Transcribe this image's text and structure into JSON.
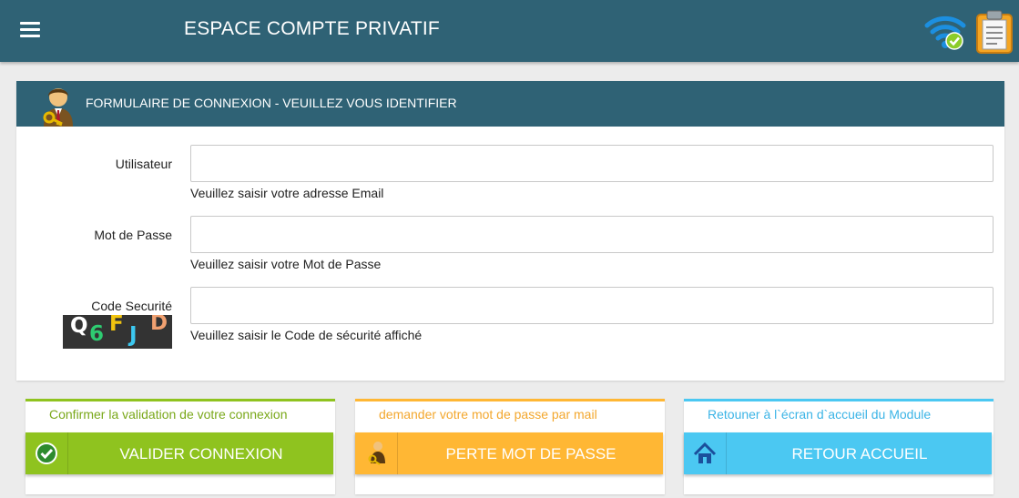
{
  "app": {
    "title": "ESPACE COMPTE PRIVATIF",
    "menu_icon": "hamburger-menu-icon",
    "status_icons": [
      "wifi-connected-icon",
      "clipboard-icon"
    ]
  },
  "form": {
    "header_title": "FORMULAIRE DE CONNEXION - VEUILLEZ VOUS IDENTIFIER",
    "header_icon": "user-key-icon",
    "fields": [
      {
        "label": "Utilisateur",
        "value": "",
        "hint": "Veuillez saisir votre adresse Email"
      },
      {
        "label": "Mot de Passe",
        "value": "",
        "hint": "Veuillez saisir votre Mot de Passe"
      },
      {
        "label": "Code Securité",
        "value": "",
        "hint": "Veuillez saisir le Code de sécurité affiché"
      }
    ],
    "captcha": {
      "chars": [
        "Q",
        "6",
        "F",
        "J",
        "D"
      ],
      "colors": [
        "#ffffff",
        "#2ecc71",
        "#f1c40f",
        "#3cc8f0",
        "#f0a070"
      ]
    }
  },
  "actions": [
    {
      "caption": "Confirmer la validation de votre connexion",
      "label": "VALIDER CONNEXION",
      "icon": "check-circle-icon",
      "color": "#8fc31f",
      "caption_color": "#7aa81a"
    },
    {
      "caption": "demander votre mot de passe par mail",
      "label": "PERTE MOT DE PASSE",
      "icon": "person-key-icon",
      "color": "#ffb734",
      "caption_color": "#f3a72d"
    },
    {
      "caption": "Retouner à l`écran d`accueil du Module",
      "label": "RETOUR ACCUEIL",
      "icon": "home-icon",
      "color": "#4bc8f2",
      "caption_color": "#3bb4e6"
    }
  ],
  "colors": {
    "header": "#2f6275",
    "background": "#ececec"
  }
}
